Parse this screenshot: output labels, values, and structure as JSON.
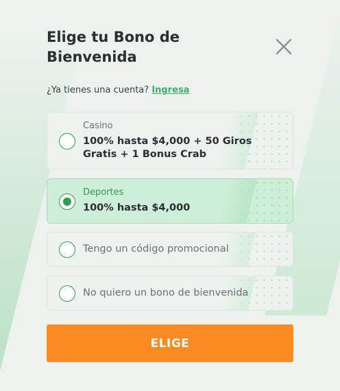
{
  "modal": {
    "title": "Elige tu Bono de Bienvenida",
    "close_icon": "close-icon",
    "account_prompt": "¿Ya tienes una cuenta?",
    "login_link": "Ingresa"
  },
  "options": [
    {
      "subtitle": "Casino",
      "label": "100% hasta $4,000 + 50 Giros Gratis + 1 Bonus Crab",
      "selected": false
    },
    {
      "subtitle": "Deportes",
      "label": "100% hasta $4,000",
      "selected": true
    },
    {
      "label": "Tengo un código promocional",
      "selected": false
    },
    {
      "label": "No quiero un bono de bienvenida",
      "selected": false
    }
  ],
  "cta": {
    "label": "ELIGE"
  },
  "colors": {
    "accent": "#2f9a54",
    "link": "#3fae66",
    "cta": "#fb8a23",
    "selected_bg": "#cdeed7"
  }
}
